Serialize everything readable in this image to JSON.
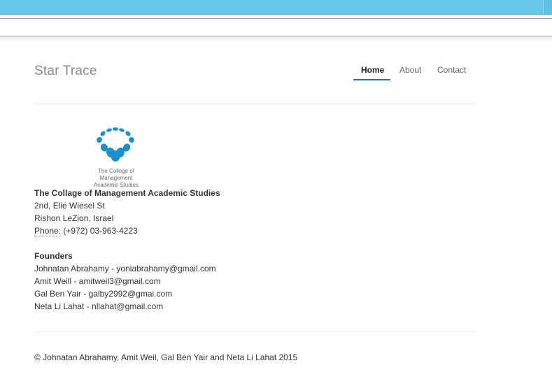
{
  "header": {
    "brand": "Star Trace",
    "nav": {
      "home": "Home",
      "about": "About",
      "contact": "Contact",
      "active": "Home"
    }
  },
  "address": {
    "logo_text_line1": "The College of Management",
    "logo_text_line2": "Academic Studies",
    "org": "The Collage of Management Academic Studies",
    "street": "2nd, Elie Wiesel St",
    "city": "Rishon LeZion, Israel",
    "phone_label": "Phone:",
    "phone": "(+972) 03-963-4223"
  },
  "founders": {
    "title": "Founders",
    "items": [
      "Johnatan Abrahamy - yoniabrahamy@gmail.com",
      "Amit Weill - amitweil3@gmail.com",
      "Gal Ben Yair - galby2992@gmai.com",
      "Neta Li Lahat - nllahat@gmail.com"
    ]
  },
  "footer": {
    "copyright": "© Johnatan Abrahamy, Amit Weil, Gal Ben Yair and Neta Li Lahat 2015"
  },
  "colors": {
    "top_bar": "#68c8ec",
    "logo_blue": "#1a90cd",
    "nav_underline": "#31708f"
  },
  "icons": {
    "logo": "college-logo-dots"
  }
}
